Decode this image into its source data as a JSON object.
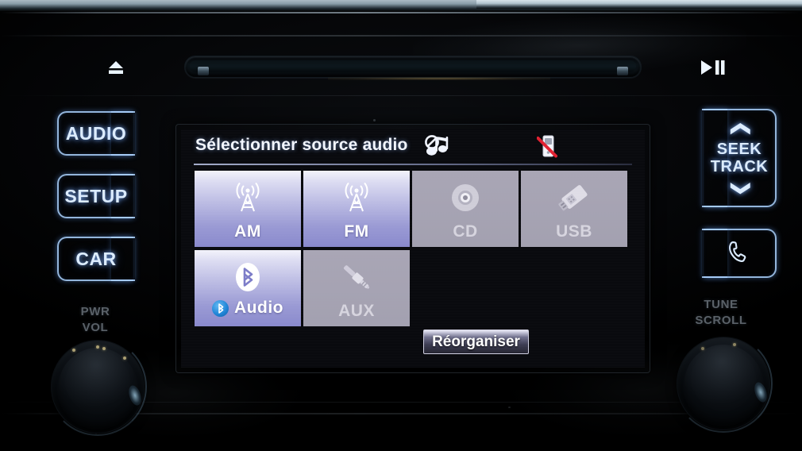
{
  "device": {
    "name": "car-audio-head-unit",
    "accent_blue": "#a8cefa",
    "tile_active_color": "#b9b9e2",
    "tile_disabled_color": "#a5a2b2"
  },
  "top_controls": {
    "eject": {
      "label": "⏏",
      "name": "eject-button"
    },
    "play_pause": {
      "label": "▶❙❙",
      "name": "play-pause-button"
    },
    "cd_slot_name": "cd-slot"
  },
  "left_keys": [
    {
      "label": "AUDIO",
      "name": "audio-key"
    },
    {
      "label": "SETUP",
      "name": "setup-key"
    },
    {
      "label": "CAR",
      "name": "car-key"
    }
  ],
  "right_keys": {
    "seek": {
      "line1": "SEEK",
      "line2": "TRACK",
      "chevron_up": "❯",
      "chevron_down": "❮"
    },
    "phone": {
      "icon": "phone-handset-icon"
    }
  },
  "knobs": [
    {
      "label_line1": "PWR",
      "label_line2": "VOL",
      "name": "power-volume-knob"
    },
    {
      "label_line1": "TUNE",
      "label_line2": "SCROLL",
      "name": "tune-scroll-knob"
    }
  ],
  "screen": {
    "title": "Sélectionner source audio",
    "status_icons": [
      {
        "name": "music-muted-icon",
        "meaning": "music note with mute slash"
      },
      {
        "name": "phone-disconnected-icon",
        "meaning": "phone with red disconnect slash"
      }
    ],
    "sources": [
      {
        "label": "AM",
        "icon": "radio-tower-icon",
        "enabled": true,
        "name": "source-am"
      },
      {
        "label": "FM",
        "icon": "radio-tower-icon",
        "enabled": true,
        "name": "source-fm"
      },
      {
        "label": "CD",
        "icon": "compact-disc-icon",
        "enabled": false,
        "name": "source-cd"
      },
      {
        "label": "USB",
        "icon": "usb-stick-icon",
        "enabled": false,
        "name": "source-usb"
      },
      {
        "label": "Audio",
        "icon": "bluetooth-icon",
        "enabled": true,
        "name": "source-bluetooth-audio",
        "badge": "bluetooth-badge-icon"
      },
      {
        "label": "AUX",
        "icon": "aux-jack-icon",
        "enabled": false,
        "name": "source-aux"
      }
    ],
    "reorganize_label": "Réorganiser"
  }
}
